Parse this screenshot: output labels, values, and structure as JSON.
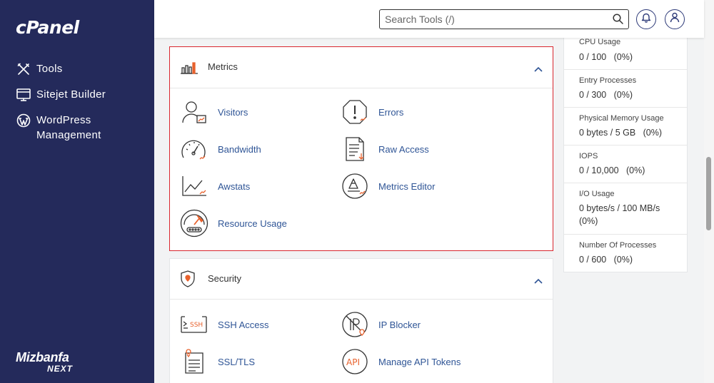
{
  "sidebar": {
    "logo": "cPanel",
    "items": [
      {
        "label": "Tools",
        "icon": "tools-icon"
      },
      {
        "label": "Sitejet Builder",
        "icon": "sitejet-icon"
      },
      {
        "label": "WordPress Management",
        "icon": "wordpress-icon"
      }
    ],
    "brand": {
      "line1": "Mizbanfa",
      "line2": "NEXT"
    }
  },
  "header": {
    "search_placeholder": "Search Tools (/)",
    "icons": [
      "search-icon",
      "bell-icon",
      "user-icon"
    ]
  },
  "metrics": {
    "title": "Metrics",
    "items": [
      {
        "label": "Visitors",
        "icon": "visitors-icon"
      },
      {
        "label": "Errors",
        "icon": "errors-icon"
      },
      {
        "label": "Bandwidth",
        "icon": "bandwidth-icon"
      },
      {
        "label": "Raw Access",
        "icon": "raw-access-icon"
      },
      {
        "label": "Awstats",
        "icon": "awstats-icon"
      },
      {
        "label": "Metrics Editor",
        "icon": "metrics-editor-icon"
      },
      {
        "label": "Resource Usage",
        "icon": "resource-usage-icon"
      }
    ]
  },
  "security": {
    "title": "Security",
    "items": [
      {
        "label": "SSH Access",
        "icon": "ssh-icon"
      },
      {
        "label": "IP Blocker",
        "icon": "ip-blocker-icon"
      },
      {
        "label": "SSL/TLS",
        "icon": "ssl-tls-icon"
      },
      {
        "label": "Manage API Tokens",
        "icon": "api-icon"
      }
    ]
  },
  "stats": [
    {
      "label": "CPU Usage",
      "value": "0 / 100   (0%)"
    },
    {
      "label": "Entry Processes",
      "value": "0 / 300   (0%)"
    },
    {
      "label": "Physical Memory Usage",
      "value": "0 bytes / 5 GB   (0%)"
    },
    {
      "label": "IOPS",
      "value": "0 / 10,000   (0%)"
    },
    {
      "label": "I/O Usage",
      "value": "0 bytes/s / 100 MB/s   (0%)"
    },
    {
      "label": "Number Of Processes",
      "value": "0 / 600   (0%)"
    }
  ],
  "colors": {
    "sidebar_bg": "#242a5b",
    "link": "#2f5596",
    "highlight_border": "#d9262e",
    "accent_orange": "#e8612c"
  }
}
